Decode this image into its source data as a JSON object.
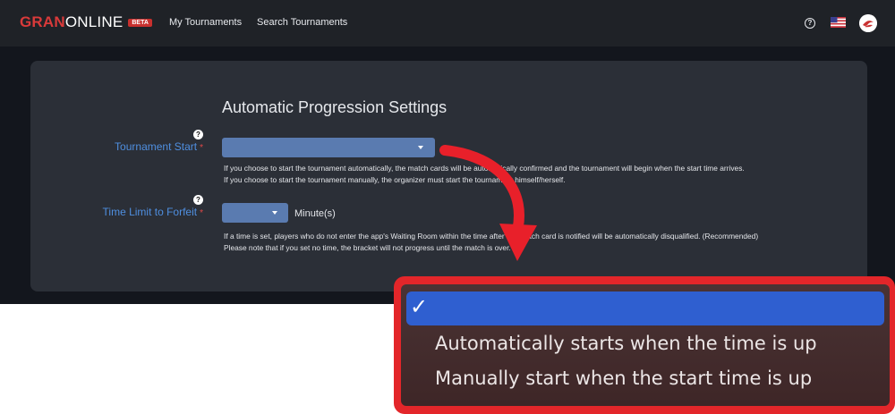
{
  "header": {
    "logo": {
      "part1": "GRAN",
      "part2": "ONLINE"
    },
    "beta_badge": "BETA",
    "nav": [
      "My Tournaments",
      "Search Tournaments"
    ],
    "help_glyph": "?",
    "flag_icon": "us-flag-icon",
    "avatar_icon": "user-avatar-icon"
  },
  "settings": {
    "heading": "Automatic Progression Settings",
    "tournament_start": {
      "label": "Tournament Start",
      "required_mark": "*",
      "help_glyph": "?",
      "selected_value": "",
      "note_line1": "If you choose to start the tournament automatically, the match cards will be automatically confirmed and the tournament will begin when the start time arrives.",
      "note_line2": "If you choose to start the tournament manually, the organizer must start the tournament himself/herself."
    },
    "time_limit": {
      "label": "Time Limit to Forfeit",
      "required_mark": "*",
      "help_glyph": "?",
      "selected_value": "",
      "unit": "Minute(s)",
      "note_line1": "If a time is set, players who do not enter the app's Waiting Room within the time after the match card is notified will be automatically disqualified. (Recommended)",
      "note_line2": "Please note that if you set no time, the bracket will not progress until the match is over."
    }
  },
  "dropdown": {
    "check_glyph": "✓",
    "options": [
      "",
      "Automatically starts when the time is up",
      "Manually start when the start time is up"
    ],
    "selected_index": 0
  },
  "colors": {
    "header_bg": "#1f2227",
    "page_bg": "#13161d",
    "card_bg": "#2b2f37",
    "label_blue": "#4f8fe0",
    "select_bg": "#5a7bb0",
    "highlight_red": "#e3262a",
    "selected_blue": "#2f5fd0"
  }
}
